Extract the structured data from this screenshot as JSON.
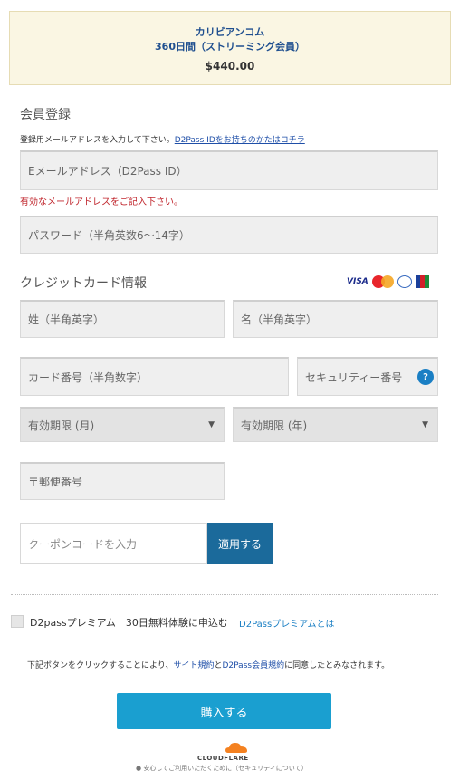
{
  "summary": {
    "product": "カリビアンコム",
    "plan": "360日間（ストリーミング会員）",
    "price": "$440.00"
  },
  "registration": {
    "title": "会員登録",
    "instruction": "登録用メールアドレスを入力して下さい。",
    "d2pass_link": "D2Pass IDをお持ちのかたはコチラ",
    "email_placeholder": "Eメールアドレス（D2Pass ID）",
    "email_error": "有効なメールアドレスをご記入下さい。",
    "password_placeholder": "パスワード（半角英数6～14字）"
  },
  "card": {
    "title": "クレジットカード情報",
    "brands": [
      "visa-icon",
      "mastercard-icon",
      "diners-icon",
      "jcb-icon"
    ],
    "visa_label": "VISA",
    "last_name_placeholder": "姓（半角英字）",
    "first_name_placeholder": "名（半角英字）",
    "number_placeholder": "カード番号（半角数字）",
    "security_placeholder": "セキュリティー番号",
    "help_label": "?",
    "expiry_month": "有効期限 (月)",
    "expiry_year": "有効期限 (年)",
    "postal_placeholder": "〒郵便番号"
  },
  "coupon": {
    "placeholder": "クーポンコードを入力",
    "apply_label": "適用する"
  },
  "premium": {
    "label": "D2passプレミアム　30日無料体験に申込む",
    "link": "D2Passプレミアムとは"
  },
  "agreement": {
    "prefix": "下記ボタンをクリックすることにより、",
    "site_terms": "サイト規約",
    "and": "と",
    "member_terms": "D2Pass会員規約",
    "suffix": "に同意したとみなされます。"
  },
  "buy_label": "購入する",
  "footer": {
    "brand": "CLOUDFLARE",
    "note": "安心してご利用いただくために（セキュリティについて）"
  },
  "colors": {
    "accent": "#1a9fd0",
    "apply": "#1b6a9b",
    "error": "#c0262d",
    "link": "#1f4fa8"
  }
}
